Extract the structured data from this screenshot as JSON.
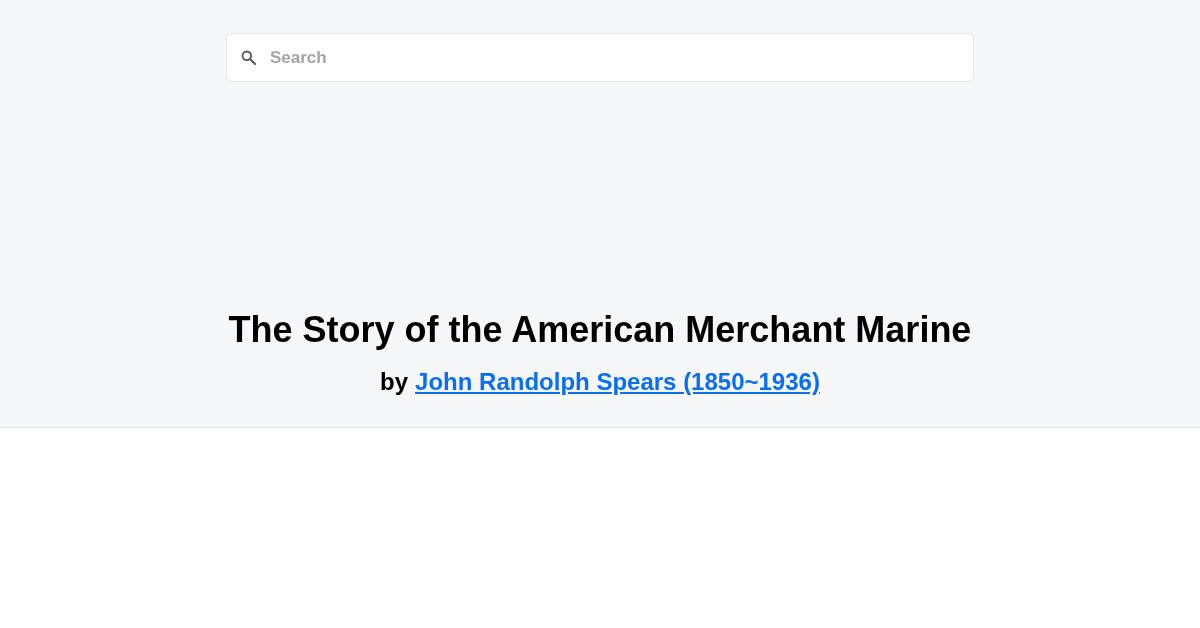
{
  "search": {
    "placeholder": "Search"
  },
  "book": {
    "title": "The Story of the American Merchant Marine",
    "byline_prefix": "by",
    "author_link": "John Randolph Spears (1850~1936)"
  }
}
